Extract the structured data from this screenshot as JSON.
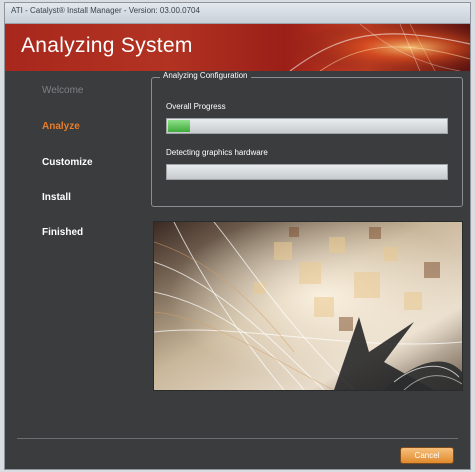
{
  "window": {
    "title": "ATI - Catalyst® Install Manager - Version: 03.00.0704"
  },
  "banner": {
    "heading": "Analyzing System"
  },
  "sidebar": {
    "steps": [
      {
        "label": "Welcome",
        "state": "done"
      },
      {
        "label": "Analyze",
        "state": "active"
      },
      {
        "label": "Customize",
        "state": "pending"
      },
      {
        "label": "Install",
        "state": "pending"
      },
      {
        "label": "Finished",
        "state": "pending"
      }
    ]
  },
  "analysis": {
    "group_title": "Analyzing Configuration",
    "overall_label": "Overall Progress",
    "overall_progress": 0.08,
    "detect_label": "Detecting graphics hardware",
    "detect_progress": 0.0
  },
  "footer": {
    "cancel_label": "Cancel"
  },
  "colors": {
    "accent_active": "#e67d2c",
    "banner_red": "#a8271d",
    "progress_green": "#3faa3a",
    "panel_bg": "#3a3c3e"
  }
}
